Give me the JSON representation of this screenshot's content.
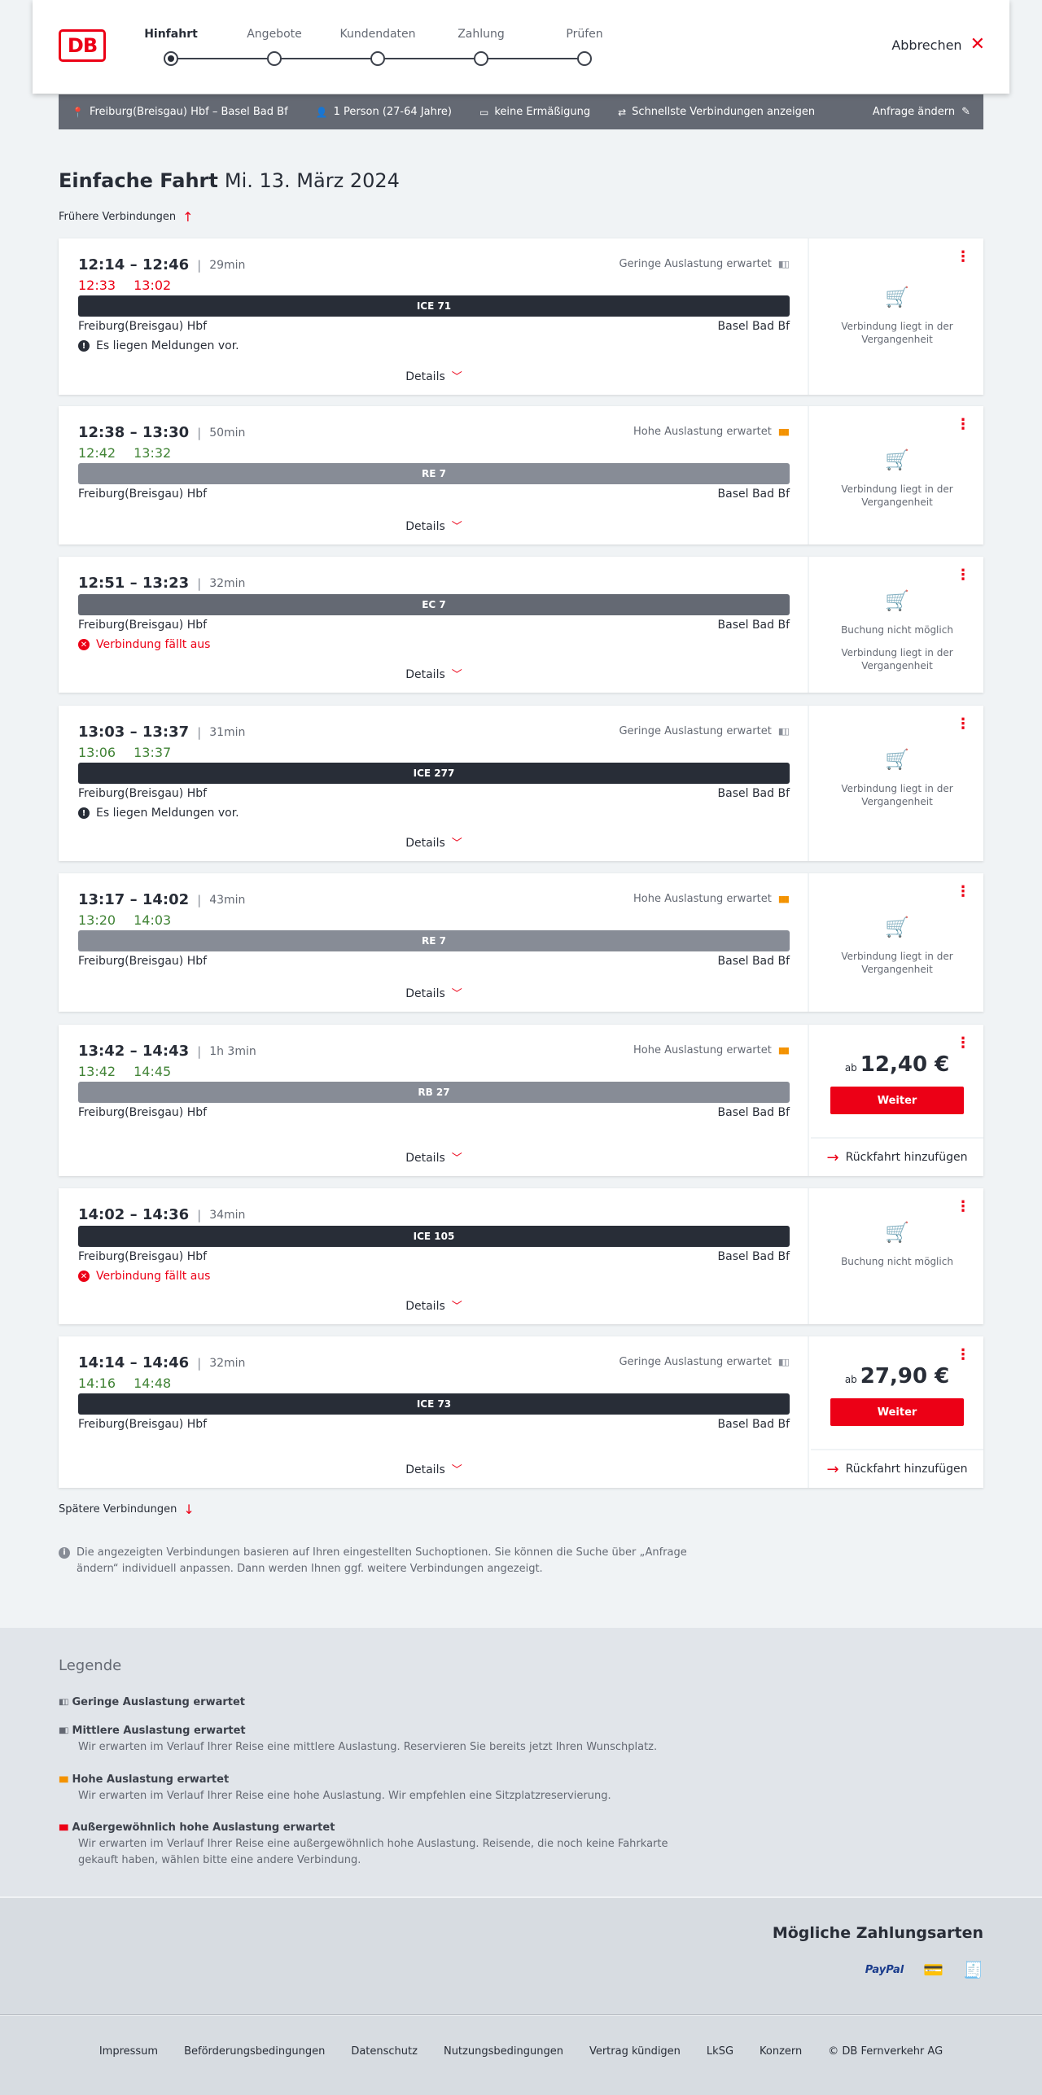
{
  "header": {
    "logo": "DB",
    "steps": [
      {
        "label": "Hinfahrt",
        "active": true
      },
      {
        "label": "Angebote",
        "active": false
      },
      {
        "label": "Kundendaten",
        "active": false
      },
      {
        "label": "Zahlung",
        "active": false
      },
      {
        "label": "Prüfen",
        "active": false
      }
    ],
    "cancel_label": "Abbrechen",
    "cancel_icon": "close-icon"
  },
  "search": {
    "route": "Freiburg(Breisgau) Hbf – Basel Bad Bf",
    "passengers": "1 Person (27-64 Jahre)",
    "discount": "keine Ermäßigung",
    "mode": "Schnellste Verbindungen anzeigen",
    "edit_label": "Anfrage ändern"
  },
  "page": {
    "title": "Einfache Fahrt",
    "date": "Mi. 13. März 2024",
    "earlier": "Frühere Verbindungen",
    "later": "Spätere Verbindungen",
    "info": "Die angezeigten Verbindungen basieren auf Ihren eingestellten Suchoptionen. Sie können die Suche über „Anfrage ändern“ individuell anpassen. Dann werden Ihnen ggf. weitere Verbindungen angezeigt."
  },
  "common": {
    "from": "Freiburg(Breisgau) Hbf",
    "to": "Basel Bad Bf",
    "details": "Details",
    "past": "Verbindung liegt in der Vergangenheit",
    "no_booking": "Buchung nicht möglich",
    "price_prefix": "ab",
    "continue": "Weiter",
    "return_trip": "Rückfahrt hinzufügen",
    "accent": "#ec0016"
  },
  "connections": [
    {
      "times": "12:14 – 12:46",
      "duration": "29min",
      "rt_dep": "12:33",
      "rt_arr": "13:02",
      "rt_status": "late",
      "load": "Geringe Auslastung erwartet",
      "load_level": "low",
      "train": "ICE 71",
      "message": "Es liegen Meldungen vor."
    },
    {
      "times": "12:38 – 13:30",
      "duration": "50min",
      "rt_dep": "12:42",
      "rt_arr": "13:32",
      "rt_status": "on_time",
      "load": "Hohe Auslastung erwartet",
      "load_level": "high",
      "train": "RE 7"
    },
    {
      "times": "12:51 – 13:23",
      "duration": "32min",
      "train": "EC 7",
      "cancelled": "Verbindung fällt aus"
    },
    {
      "times": "13:03 – 13:37",
      "duration": "31min",
      "rt_dep": "13:06",
      "rt_arr": "13:37",
      "rt_status": "on_time",
      "load": "Geringe Auslastung erwartet",
      "load_level": "low",
      "train": "ICE 277",
      "message": "Es liegen Meldungen vor."
    },
    {
      "times": "13:17 – 14:02",
      "duration": "43min",
      "rt_dep": "13:20",
      "rt_arr": "14:03",
      "rt_status": "on_time",
      "load": "Hohe Auslastung erwartet",
      "load_level": "high",
      "train": "RE 7"
    },
    {
      "times": "13:42 – 14:43",
      "duration": "1h 3min",
      "rt_dep": "13:42",
      "rt_arr": "14:45",
      "rt_status": "on_time",
      "load": "Hohe Auslastung erwartet",
      "load_level": "high",
      "train": "RB 27",
      "price": "12,40 €"
    },
    {
      "times": "14:02 – 14:36",
      "duration": "34min",
      "train": "ICE 105",
      "cancelled": "Verbindung fällt aus"
    },
    {
      "times": "14:14 – 14:46",
      "duration": "32min",
      "rt_dep": "14:16",
      "rt_arr": "14:48",
      "rt_status": "on_time",
      "load": "Geringe Auslastung erwartet",
      "load_level": "low",
      "train": "ICE 73",
      "price": "27,90 €"
    }
  ],
  "legend": {
    "title": "Legende",
    "items": [
      {
        "title": "Geringe Auslastung erwartet",
        "level": "low",
        "desc": ""
      },
      {
        "title": "Mittlere Auslastung erwartet",
        "level": "medium",
        "desc": "Wir erwarten im Verlauf Ihrer Reise eine mittlere Auslastung. Reservieren Sie bereits jetzt Ihren Wunschplatz."
      },
      {
        "title": "Hohe Auslastung erwartet",
        "level": "high",
        "desc": "Wir erwarten im Verlauf Ihrer Reise eine hohe Auslastung. Wir empfehlen eine Sitzplatzreservierung."
      },
      {
        "title": "Außergewöhnlich hohe Auslastung erwartet",
        "level": "exceptional",
        "desc": "Wir erwarten im Verlauf Ihrer Reise eine außergewöhnlich hohe Auslastung. Reisende, die noch keine Fahrkarte gekauft haben, wählen bitte eine andere Verbindung."
      }
    ]
  },
  "payment": {
    "title": "Mögliche Zahlungsarten",
    "paypal": "PayPal"
  },
  "footer": {
    "links": [
      "Impressum",
      "Beförderungsbedingungen",
      "Datenschutz",
      "Nutzungsbedingungen",
      "Vertrag kündigen",
      "LkSG",
      "Konzern",
      "© DB Fernverkehr AG"
    ]
  }
}
